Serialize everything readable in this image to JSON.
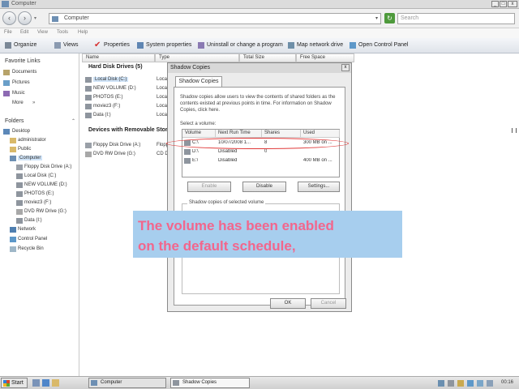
{
  "window": {
    "title": "Computer"
  },
  "address": {
    "path": "Computer",
    "search_placeholder": "Search"
  },
  "menu": [
    "File",
    "Edit",
    "View",
    "Tools",
    "Help"
  ],
  "toolbar": [
    "Organize",
    "Views",
    "Properties",
    "System properties",
    "Uninstall or change a program",
    "Map network drive",
    "Open Control Panel"
  ],
  "favorites": {
    "heading": "Favorite Links",
    "items": [
      "Documents",
      "Pictures",
      "Music",
      "More"
    ]
  },
  "folders": {
    "heading": "Folders",
    "items": [
      "Desktop",
      "administrator",
      "Public",
      "Computer",
      "Floppy Disk Drive (A:)",
      "Local Disk (C:)",
      "NEW VOLUME (D:)",
      "PHOTOS (E:)",
      "moviez3 (F:)",
      "DVD RW Drive (G:)",
      "Data (I:)",
      "Network",
      "Control Panel",
      "Recycle Bin"
    ]
  },
  "columns": [
    "Name",
    "Type",
    "Total Size",
    "Free Space"
  ],
  "main": {
    "hdd_heading": "Hard Disk Drives (5)",
    "hdd": [
      "Local Disk (C:)",
      "NEW VOLUME (D:)",
      "PHOTOS (E:)",
      "moviez3 (F:)",
      "Data (I:)"
    ],
    "hdd_type": "Local",
    "removable_heading": "Devices with Removable Storage",
    "removable": [
      "Floppy Disk Drive (A:)",
      "DVD RW Drive (G:)"
    ],
    "removable_type": [
      "Flopp",
      "CD D"
    ]
  },
  "dialog": {
    "title": "Shadow Copies",
    "tab": "Shadow Copies",
    "description": "Shadow copies allow users to view the contents of shared folders as the contents existed at previous points in time. For information on Shadow Copies, click here.",
    "select_label": "Select a volume:",
    "vol_headers": [
      "Volume",
      "Next Run Time",
      "Shares",
      "Used"
    ],
    "volumes": [
      {
        "volume": "C:\\",
        "next": "10/07/2008 1...",
        "shares": "8",
        "used": "300 MB on ..."
      },
      {
        "volume": "D:\\",
        "next": "Disabled",
        "shares": "0",
        "used": ""
      },
      {
        "volume": "E:\\",
        "next": "Disabled",
        "shares": "",
        "used": "400 MB on ..."
      }
    ],
    "buttons": {
      "enable": "Enable",
      "disable": "Disable",
      "settings": "Settings...",
      "ok": "OK",
      "cancel": "Cancel"
    },
    "group_label": "Shadow copies of selected volume"
  },
  "caption": {
    "line1": "The volume has been enabled",
    "line2": "on the default schedule,"
  },
  "taskbar": {
    "start": "Start",
    "tasks": [
      "Computer",
      "Shadow Copies"
    ],
    "clock": "00:16"
  }
}
